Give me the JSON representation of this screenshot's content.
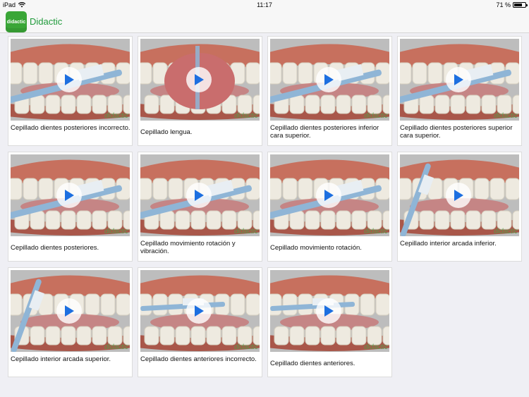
{
  "status_bar": {
    "device": "iPad",
    "time": "11:17",
    "battery": "71 %",
    "battery_level": 0.71
  },
  "app": {
    "logo_text": "didactic",
    "title": "Didactic"
  },
  "videos": [
    {
      "caption": "Cepillado dientes posteriores incorrecto.",
      "watermark": "didactic",
      "scene": "brush-right"
    },
    {
      "caption": "Cepillado lengua.",
      "watermark": "didactic",
      "scene": "tongue"
    },
    {
      "caption": "Cepillado dientes posteriores inferior cara superior.",
      "watermark": "didactic",
      "scene": "brush-lower"
    },
    {
      "caption": "Cepillado dientes posteriores superior cara superior.",
      "watermark": "didactic",
      "scene": "brush-upper"
    },
    {
      "caption": "Cepillado dientes posteriores.",
      "watermark": "didactic",
      "scene": "brush-side"
    },
    {
      "caption": "Cepillado movimiento rotación y vibración.",
      "watermark": "didactic",
      "scene": "brush-left"
    },
    {
      "caption": "Cepillado movimiento rotación.",
      "watermark": "didactic",
      "scene": "brush-lower"
    },
    {
      "caption": "Cepillado interior arcada inferior.",
      "watermark": "didactic",
      "scene": "inner-lower"
    },
    {
      "caption": "Cepillado interior arcada superior.",
      "watermark": "didactic",
      "scene": "inner-upper"
    },
    {
      "caption": "Cepillado dientes anteriores incorrecto.",
      "watermark": "didactic",
      "scene": "front-brush"
    },
    {
      "caption": "Cepillado dientes anteriores.",
      "watermark": "didactic",
      "scene": "front-brush-2"
    }
  ]
}
